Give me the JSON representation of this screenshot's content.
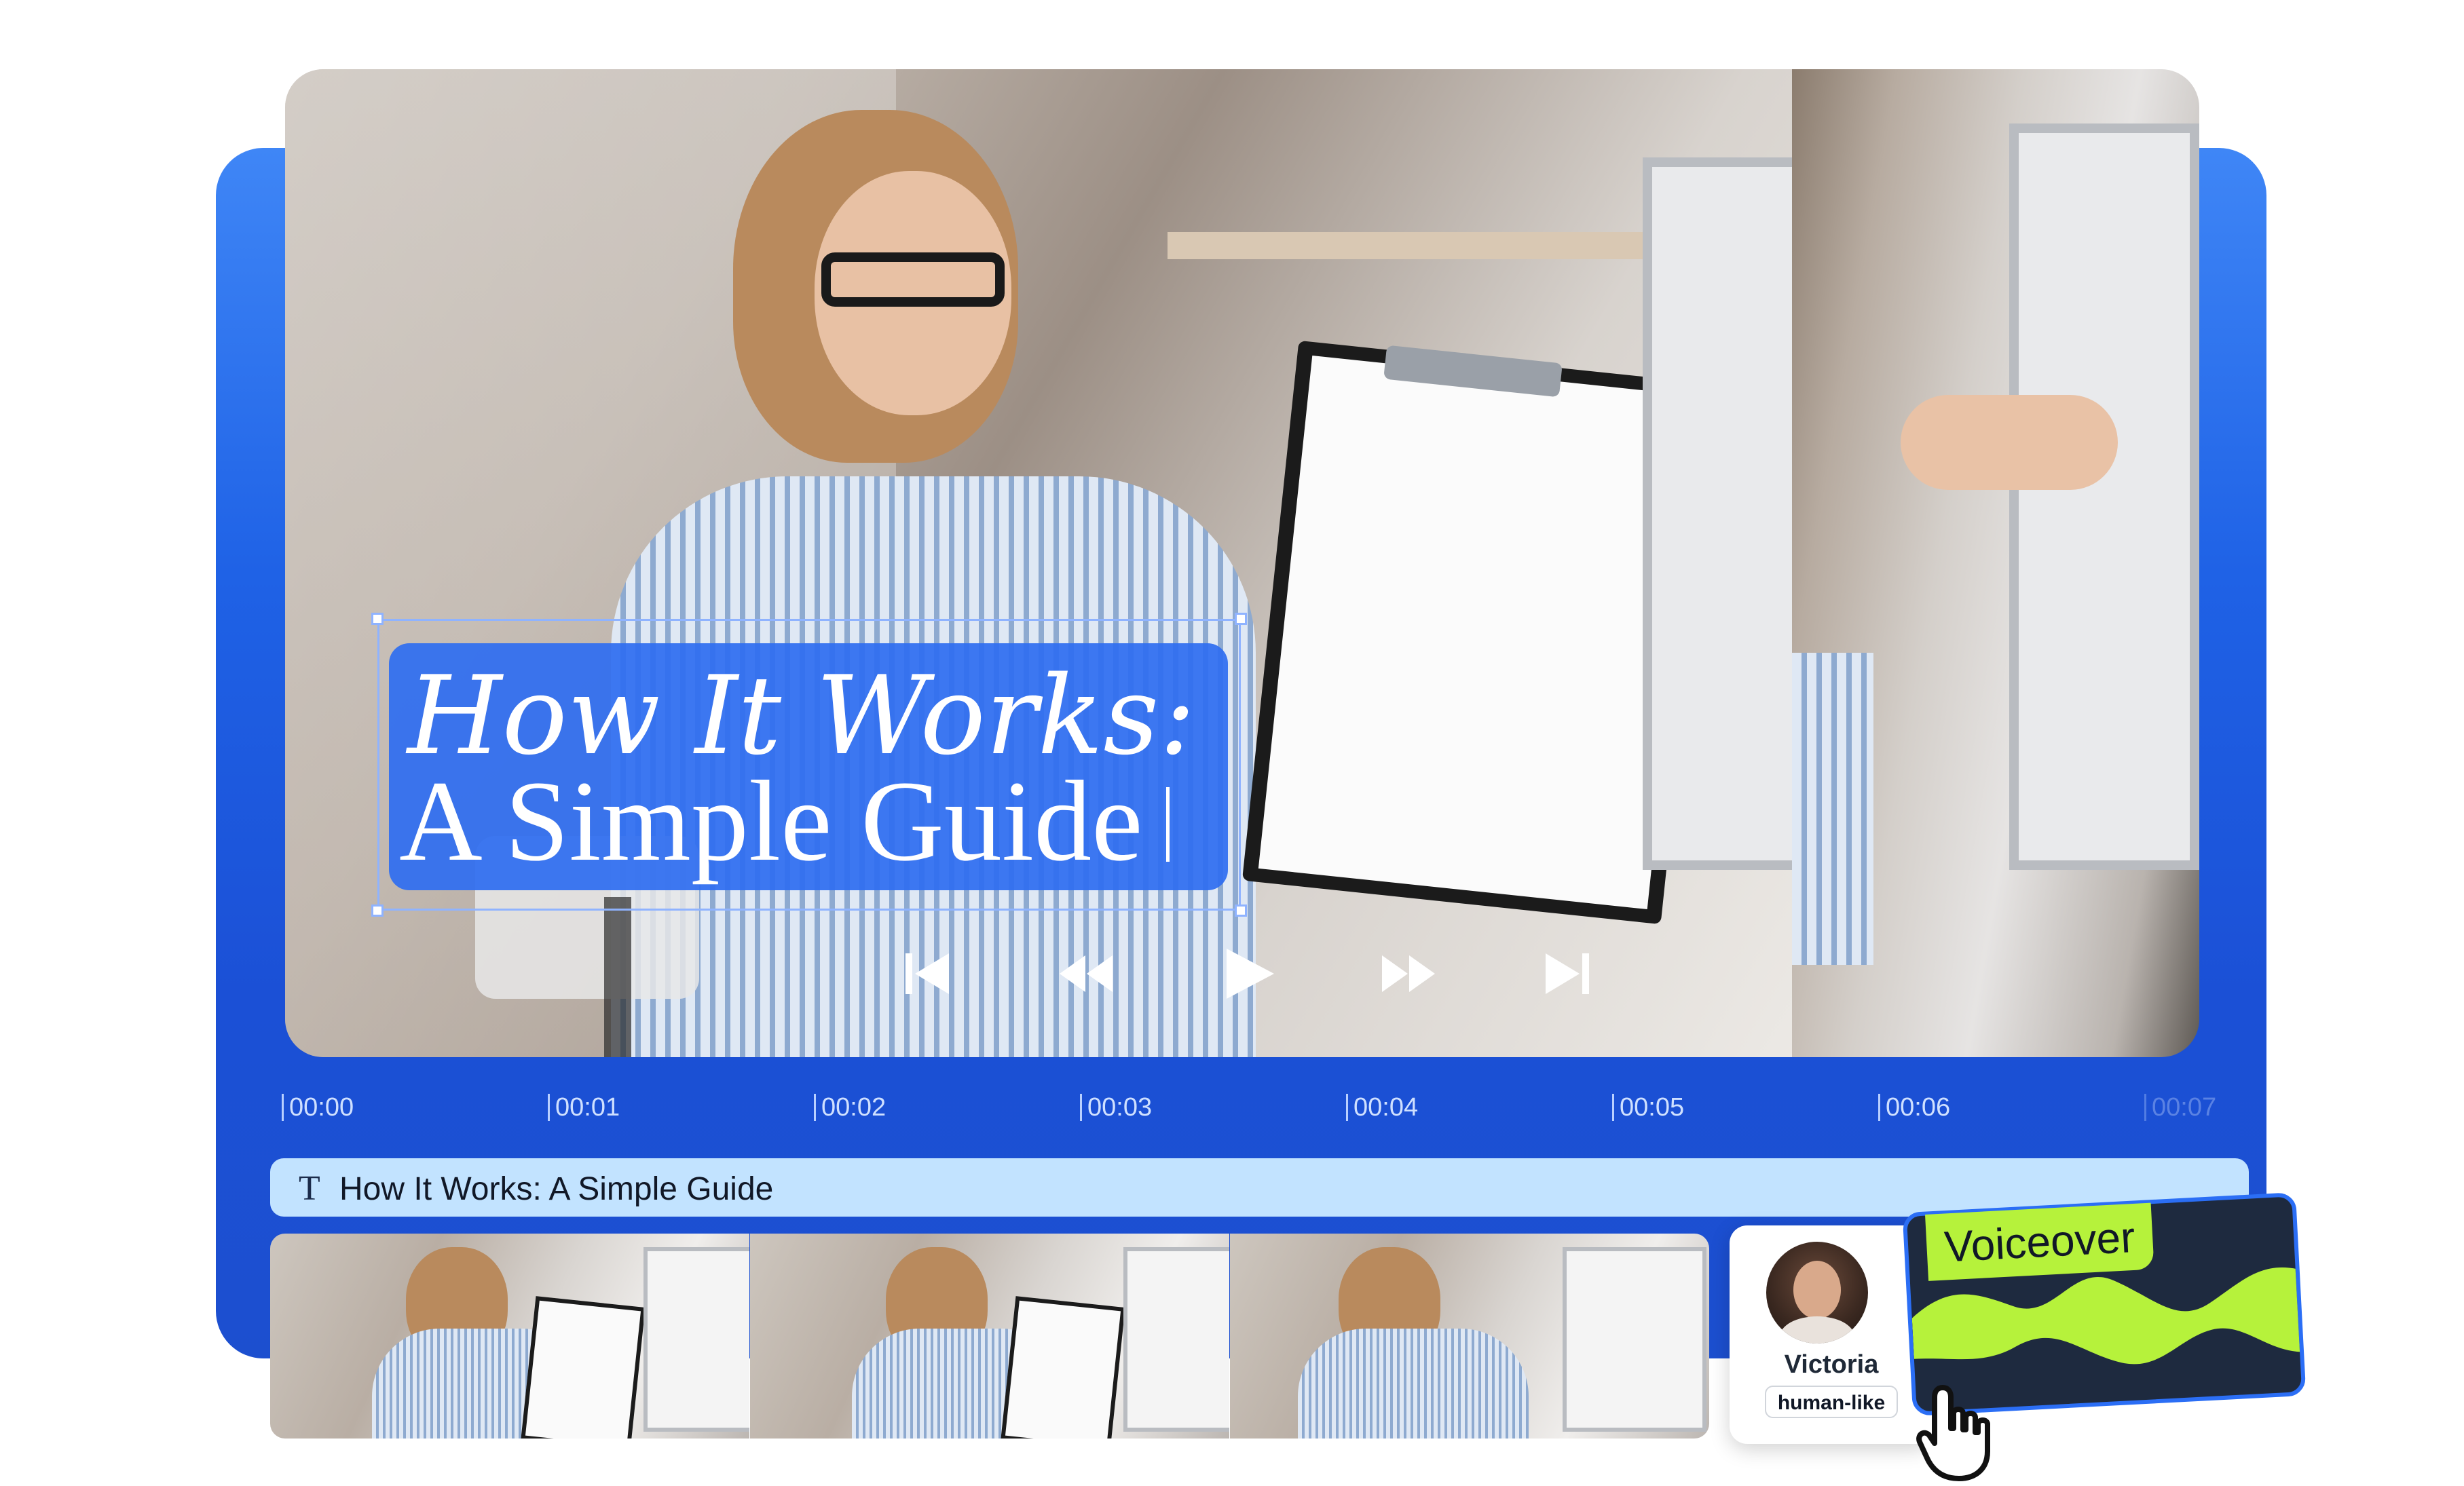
{
  "player": {
    "title_line1": "How It Works:",
    "title_line2": "A Simple Guide",
    "controls": [
      "skip-back-icon",
      "rewind-icon",
      "play-icon",
      "fast-forward-icon",
      "skip-forward-icon"
    ]
  },
  "timeline": {
    "ticks": [
      "00:00",
      "00:01",
      "00:02",
      "00:03",
      "00:04",
      "00:05",
      "00:06",
      "00:07"
    ]
  },
  "text_track": {
    "icon": "T",
    "label": "How It Works: A Simple Guide"
  },
  "voice": {
    "name": "Victoria",
    "tag": "human-like",
    "panel_label": "Voiceover"
  },
  "colors": {
    "panel_blue": "#1f62e6",
    "title_box": "#2f6ef0",
    "text_track": "#c2e3ff",
    "voice_accent": "#b6f23b",
    "voice_panel": "#1e2a3f"
  }
}
